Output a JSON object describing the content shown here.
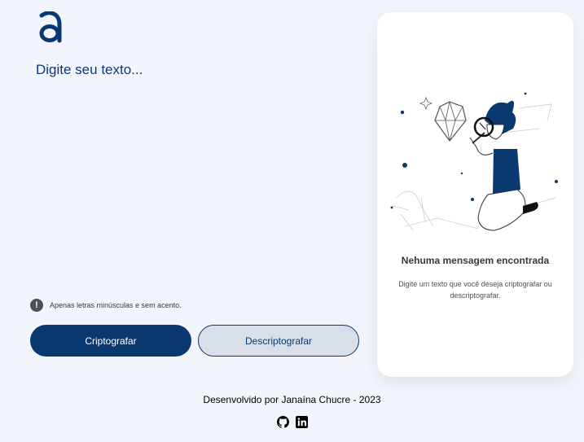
{
  "input": {
    "placeholder": "Digite seu texto..."
  },
  "hint": {
    "icon": "exclamation-circle-icon",
    "text": "Apenas letras minúsculas e sem acento."
  },
  "buttons": {
    "encrypt_label": "Criptografar",
    "decrypt_label": "Descriptografar"
  },
  "output_panel": {
    "title": "Nehuma mensagem encontrada",
    "subtitle": "Digite um texto que você deseja criptografar ou descriptografar."
  },
  "footer": {
    "text": "Desenvolvido por Janaína Chucre - 2023",
    "icons": [
      "github-icon",
      "linkedin-icon"
    ]
  },
  "colors": {
    "background": "#f3f5fc",
    "primary": "#0a3871",
    "secondary_button": "#d8dfe8",
    "panel": "#ffffff"
  }
}
